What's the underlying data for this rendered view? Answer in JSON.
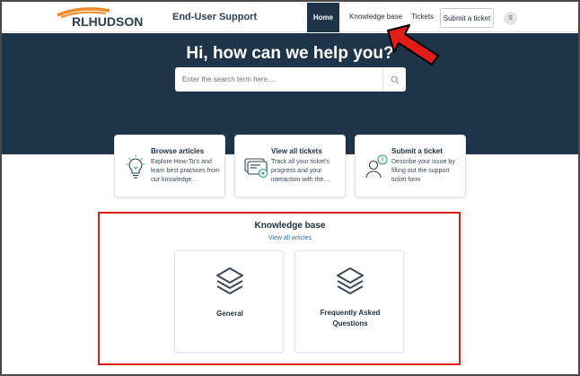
{
  "header": {
    "logo_text": "RLHUDSON",
    "site_title": "End-User Support",
    "nav": {
      "home": "Home",
      "knowledge_base": "Knowledge base",
      "tickets": "Tickets",
      "submit_ticket": "Submit a ticket",
      "avatar_initial": "S"
    }
  },
  "hero": {
    "title": "Hi, how can we help you?",
    "search_placeholder": "Enter the search term here....",
    "search_icon": "search-icon"
  },
  "cards": [
    {
      "title": "Browse articles",
      "desc": "Explore How-To's and learn best practices from our knowledge…",
      "icon": "lightbulb-icon"
    },
    {
      "title": "View all tickets",
      "desc": "Track all your ticket's progress and your interaction with the…",
      "icon": "tickets-icon"
    },
    {
      "title": "Submit a ticket",
      "desc": "Describe your issue by filling out the support ticket form",
      "icon": "user-alert-icon"
    }
  ],
  "knowledge_base": {
    "title": "Knowledge base",
    "link": "View all articles",
    "categories": [
      {
        "label": "General",
        "icon": "layers-icon"
      },
      {
        "label": "Frequently Asked Questions",
        "icon": "layers-icon"
      }
    ]
  },
  "annotations": {
    "arrow_color": "#e21b1b",
    "highlight_color": "#e21b1b"
  },
  "colors": {
    "navy": "#1e3448",
    "logo_orange": "#f08a24",
    "accent_green": "#2aa876",
    "link_blue": "#2f6fb0"
  }
}
